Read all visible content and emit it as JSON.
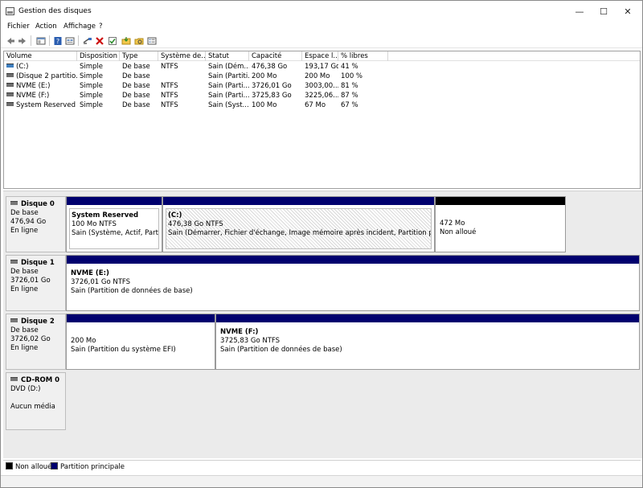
{
  "window": {
    "title": "Gestion des disques",
    "min_glyph": "—",
    "max_glyph": "☐",
    "close_glyph": "✕"
  },
  "menu": {
    "items": [
      "Fichier",
      "Action",
      "Affichage",
      "?"
    ]
  },
  "toolbar": {
    "icons": [
      "back-arrow-icon",
      "forward-arrow-icon",
      "console-tree-icon",
      "help-icon",
      "properties-icon",
      "connect-disk-icon",
      "delete-icon",
      "check-icon",
      "open-folder-icon",
      "explore-icon",
      "list-view-icon"
    ]
  },
  "listview": {
    "columns": [
      "Volume",
      "Disposition",
      "Type",
      "Système de...",
      "Statut",
      "Capacité",
      "Espace l...",
      "% libres"
    ],
    "rows": [
      [
        "(C:)",
        "Simple",
        "De base",
        "NTFS",
        "Sain (Dém...",
        "476,38 Go",
        "193,17 Go",
        "41 %"
      ],
      [
        "(Disque 2 partitio...",
        "Simple",
        "De base",
        "",
        "Sain (Partiti...",
        "200 Mo",
        "200 Mo",
        "100 %"
      ],
      [
        "NVME (E:)",
        "Simple",
        "De base",
        "NTFS",
        "Sain (Parti...",
        "3726,01 Go",
        "3003,00...",
        "81 %"
      ],
      [
        "NVME (F:)",
        "Simple",
        "De base",
        "NTFS",
        "Sain (Parti...",
        "3725,83 Go",
        "3225,06...",
        "87 %"
      ],
      [
        "System Reserved",
        "Simple",
        "De base",
        "NTFS",
        "Sain (Syst...",
        "100 Mo",
        "67 Mo",
        "67 %"
      ]
    ]
  },
  "disks": [
    {
      "name": "Disque 0",
      "type": "De base",
      "size": "476,94 Go",
      "status": "En ligne",
      "partitions": [
        {
          "name": "System Reserved",
          "size": "100 Mo NTFS",
          "status": "Sain (Système, Actif, Partition"
        },
        {
          "name": "(C:)",
          "size": "476,38 Go NTFS",
          "status": "Sain (Démarrer, Fichier d'échange, Image mémoire après incident, Partition principale)"
        },
        {
          "name": "",
          "size": "472 Mo",
          "status": "Non alloué"
        }
      ]
    },
    {
      "name": "Disque 1",
      "type": "De base",
      "size": "3726,01 Go",
      "status": "En ligne",
      "partitions": [
        {
          "name": "NVME  (E:)",
          "size": "3726,01 Go NTFS",
          "status": "Sain (Partition de données de base)"
        }
      ]
    },
    {
      "name": "Disque 2",
      "type": "De base",
      "size": "3726,02 Go",
      "status": "En ligne",
      "partitions": [
        {
          "name": "",
          "size": "200 Mo",
          "status": "Sain (Partition du système EFI)"
        },
        {
          "name": "NVME  (F:)",
          "size": "3725,83 Go NTFS",
          "status": "Sain (Partition de données de base)"
        }
      ]
    },
    {
      "name": "CD-ROM 0",
      "type": "DVD (D:)",
      "size": "",
      "status": "Aucun média",
      "partitions": []
    }
  ],
  "legend": {
    "unallocated": "Non alloué",
    "primary": "Partition principale"
  },
  "colors": {
    "primary_partition": "#00006e",
    "unallocated": "#000000"
  }
}
